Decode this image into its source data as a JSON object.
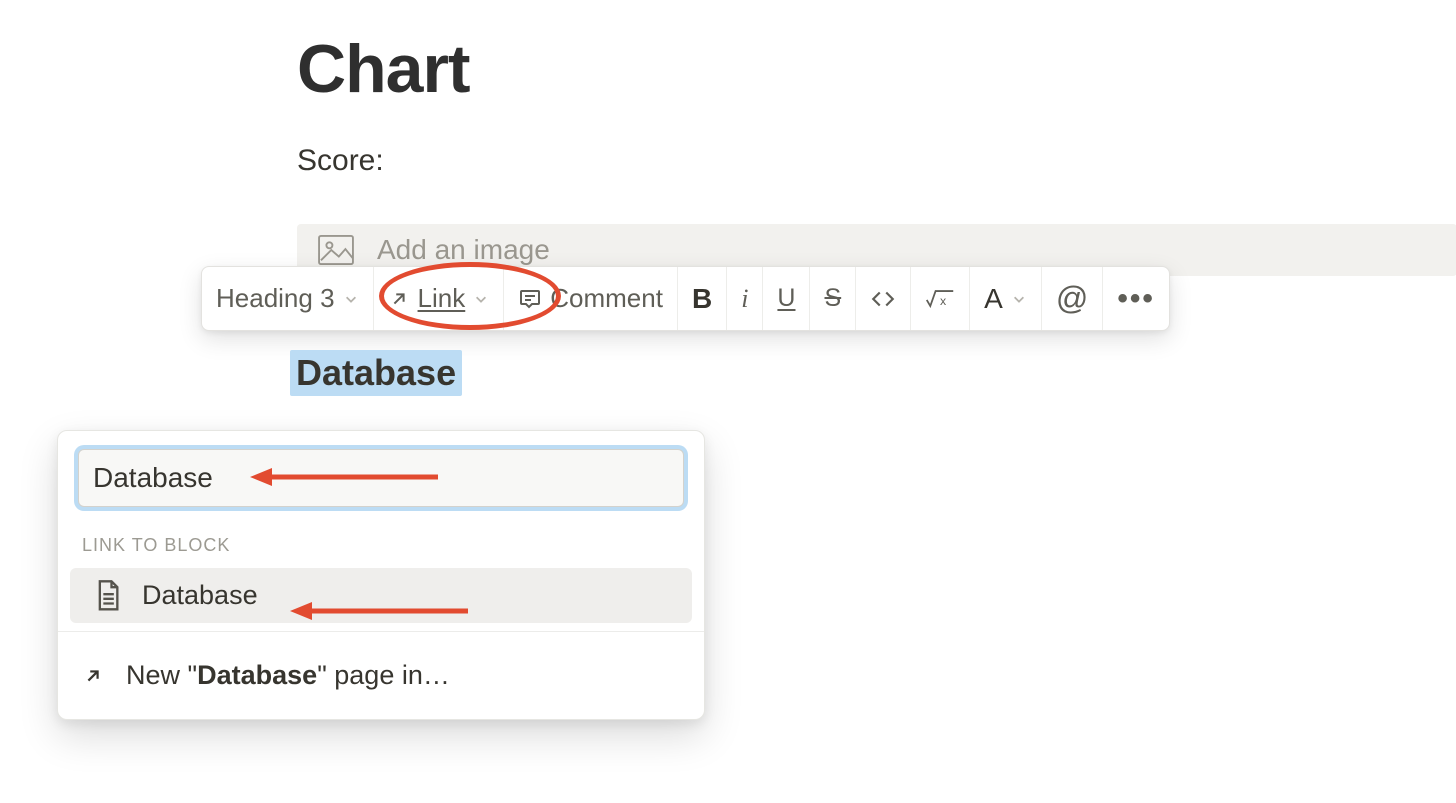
{
  "page": {
    "title": "Chart",
    "score_label": "Score:",
    "image_placeholder": "Add an image"
  },
  "toolbar": {
    "block_type": "Heading 3",
    "link_label": "Link",
    "comment_label": "Comment",
    "bold_glyph": "B",
    "italic_glyph": "i",
    "underline_glyph": "U",
    "strike_glyph": "S",
    "text_color_glyph": "A",
    "mention_glyph": "@",
    "more_glyph": "•••"
  },
  "selection": {
    "heading_text": "Database"
  },
  "link_popup": {
    "search_value": "Database",
    "section_label": "LINK TO BLOCK",
    "result_label": "Database",
    "new_page_prefix": "New \"",
    "new_page_term": "Database",
    "new_page_suffix": "\" page in…"
  }
}
